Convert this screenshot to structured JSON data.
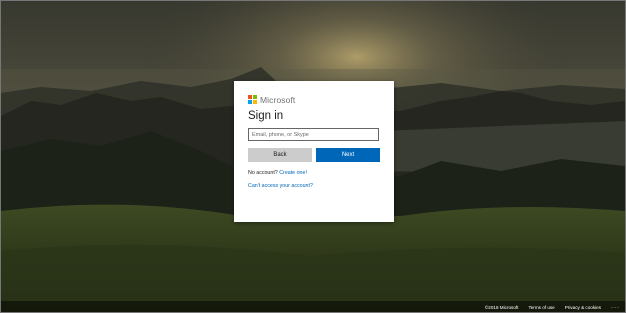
{
  "brand": {
    "name": "Microsoft",
    "logo_colors": [
      "#f25022",
      "#7fba00",
      "#00a4ef",
      "#ffb900"
    ]
  },
  "signin": {
    "title": "Sign in",
    "email_placeholder": "Email, phone, or Skype",
    "email_value": "",
    "back_label": "Back",
    "next_label": "Next",
    "no_account_text": "No account?",
    "create_link": "Create one!",
    "cant_access_link": "Can't access your account?"
  },
  "footer": {
    "copyright": "©2018 Microsoft",
    "terms": "Terms of use",
    "privacy": "Privacy & cookies",
    "more": "···"
  },
  "colors": {
    "accent": "#0067b8",
    "back_button": "#cccccc"
  }
}
